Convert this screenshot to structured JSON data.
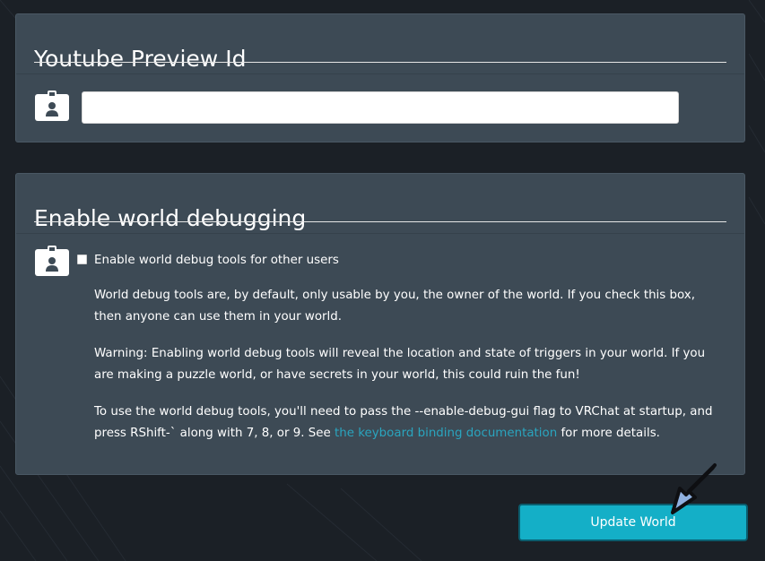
{
  "youtube_section": {
    "title": "Youtube Preview Id",
    "input_value": "",
    "input_placeholder": "",
    "icon": "id-badge-icon"
  },
  "debug_section": {
    "title": "Enable world debugging",
    "icon": "id-badge-icon",
    "checkbox_checked": false,
    "checkbox_label": "Enable world debug tools for other users",
    "paragraph_1": "World debug tools are, by default, only usable by you, the owner of the world. If you check this box, then anyone can use them in your world.",
    "paragraph_2": "Warning: Enabling world debug tools will reveal the location and state of triggers in your world. If you are making a puzzle world, or have secrets in your world, this could ruin the fun!",
    "paragraph_3_before": "To use the world debug tools, you'll need to pass the --enable-debug-gui flag to VRChat at startup, and press RShift-` along with 7, 8, or 9. See ",
    "paragraph_3_link": "the keyboard binding documentation",
    "paragraph_3_after": " for more details."
  },
  "actions": {
    "update_label": "Update World"
  },
  "colors": {
    "background": "#1b2026",
    "panel": "#3d4a55",
    "accent": "#14afc7",
    "link": "#2aa5bf",
    "annotation_arrow": "#8fb0df"
  }
}
